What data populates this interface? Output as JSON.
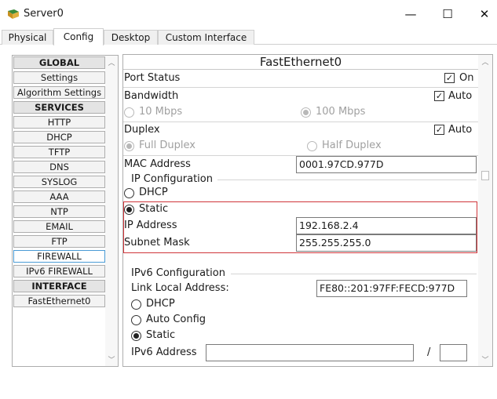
{
  "window": {
    "title": "Server0",
    "minimize_glyph": "—",
    "maximize_glyph": "☐",
    "close_glyph": "✕",
    "icon": "server-app-icon"
  },
  "tabs": [
    {
      "label": "Physical",
      "active": false
    },
    {
      "label": "Config",
      "active": true
    },
    {
      "label": "Desktop",
      "active": false
    },
    {
      "label": "Custom Interface",
      "active": false
    }
  ],
  "nav": {
    "items": [
      {
        "label": "GLOBAL",
        "header": true
      },
      {
        "label": "Settings",
        "header": false
      },
      {
        "label": "Algorithm Settings",
        "header": false
      },
      {
        "label": "SERVICES",
        "header": true
      },
      {
        "label": "HTTP",
        "header": false
      },
      {
        "label": "DHCP",
        "header": false
      },
      {
        "label": "TFTP",
        "header": false
      },
      {
        "label": "DNS",
        "header": false
      },
      {
        "label": "SYSLOG",
        "header": false
      },
      {
        "label": "AAA",
        "header": false
      },
      {
        "label": "NTP",
        "header": false
      },
      {
        "label": "EMAIL",
        "header": false
      },
      {
        "label": "FTP",
        "header": false
      },
      {
        "label": "FIREWALL",
        "header": false,
        "selected": true
      },
      {
        "label": "IPv6 FIREWALL",
        "header": false
      },
      {
        "label": "INTERFACE",
        "header": true
      },
      {
        "label": "FastEthernet0",
        "header": false
      }
    ]
  },
  "interface": {
    "title": "FastEthernet0",
    "port_status": {
      "label": "Port Status",
      "option": "On",
      "checked": true
    },
    "bandwidth": {
      "label": "Bandwidth",
      "auto_label": "Auto",
      "auto_checked": true,
      "opt1": "10 Mbps",
      "opt2": "100 Mbps",
      "selected": "100 Mbps"
    },
    "duplex": {
      "label": "Duplex",
      "auto_label": "Auto",
      "auto_checked": true,
      "opt1": "Full Duplex",
      "opt2": "Half Duplex",
      "selected": "Full Duplex"
    },
    "mac": {
      "label": "MAC Address",
      "value": "0001.97CD.977D"
    },
    "ipv4": {
      "group_label": "IP Configuration",
      "dhcp_label": "DHCP",
      "static_label": "Static",
      "mode": "Static",
      "ip_label": "IP Address",
      "ip_value": "192.168.2.4",
      "mask_label": "Subnet Mask",
      "mask_value": "255.255.255.0"
    },
    "ipv6": {
      "group_label": "IPv6 Configuration",
      "link_local_label": "Link Local Address:",
      "link_local_value": "FE80::201:97FF:FECD:977D",
      "dhcp_label": "DHCP",
      "auto_label": "Auto Config",
      "static_label": "Static",
      "mode": "Static",
      "address_label": "IPv6 Address",
      "address_value": "",
      "slash": "/",
      "prefix_value": ""
    }
  },
  "colors": {
    "highlight_border": "#d0353a",
    "selected_nav_border": "#4a9bd5"
  }
}
